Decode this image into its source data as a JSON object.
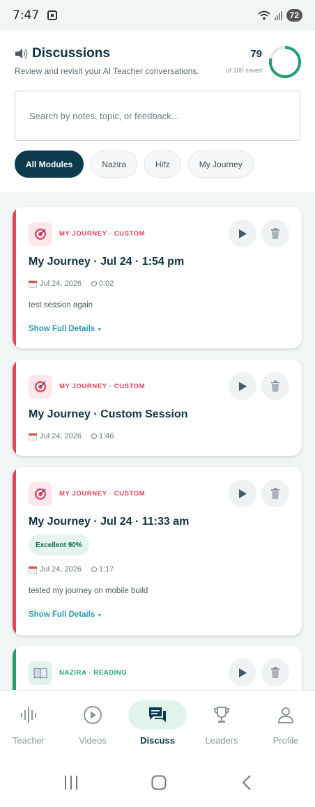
{
  "status": {
    "time": "7:47",
    "battery": "72"
  },
  "header": {
    "title": "Discussions",
    "subtitle": "Review and revisit your AI Teacher conversations.",
    "saved_count": "79",
    "saved_label": "of 100 saved",
    "saved_fraction": 0.79
  },
  "search": {
    "placeholder": "Search by notes, topic, or feedback..."
  },
  "filters": [
    "All Modules",
    "Nazira",
    "Hifz",
    "My Journey"
  ],
  "cards": [
    {
      "module": "MY JOURNEY · CUSTOM",
      "title": "My Journey · Jul 24 · 1:54 pm",
      "date": "Jul 24, 2026",
      "duration": "0:02",
      "note": "test session again",
      "details": "Show Full Details",
      "accent": "#e8435a"
    },
    {
      "module": "MY JOURNEY · CUSTOM",
      "title": "My Journey · Custom Session",
      "date": "Jul 24, 2026",
      "duration": "1:46",
      "accent": "#e8435a"
    },
    {
      "module": "MY JOURNEY · CUSTOM",
      "title": "My Journey · Jul 24 · 11:33 am",
      "score": "Excellent 90%",
      "date": "Jul 24, 2026",
      "duration": "1:17",
      "note": "tested my journey on mobile build",
      "details": "Show Full Details",
      "accent": "#e8435a"
    },
    {
      "module": "NAZIRA · READING",
      "accent": "#22a06b"
    }
  ],
  "nav": [
    "Teacher",
    "Videos",
    "Discuss",
    "Leaders",
    "Profile"
  ],
  "colors": {
    "primary": "#0d3a4c",
    "journey": "#e8435a",
    "nazira": "#22a06b",
    "link": "#2a9ab6"
  }
}
